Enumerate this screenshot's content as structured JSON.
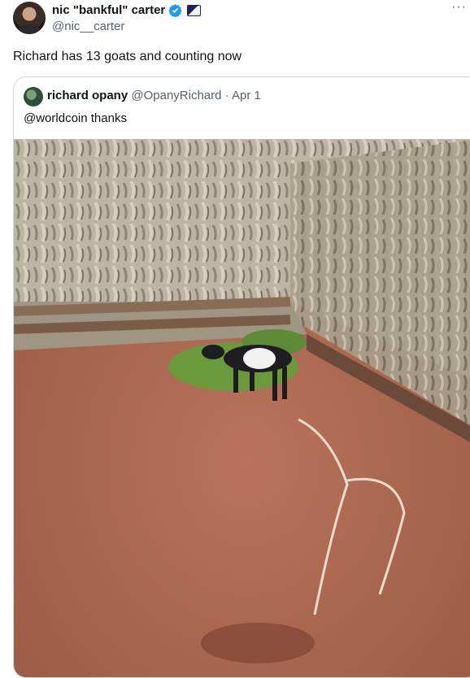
{
  "author": {
    "name": "nic \"bankful\" carter",
    "handle": "@nic__carter",
    "verified_color": "#1d9bf0"
  },
  "menu": {
    "more_glyph": "···"
  },
  "tweet": {
    "text": "Richard has 13 goats and counting now"
  },
  "quoted": {
    "name": "richard opany",
    "handle": "@OpanyRichard",
    "separator": "·",
    "date": "Apr 1",
    "text": "@worldcoin thanks"
  },
  "colors": {
    "secondary_text": "#536471",
    "border": "#cfd9de"
  }
}
